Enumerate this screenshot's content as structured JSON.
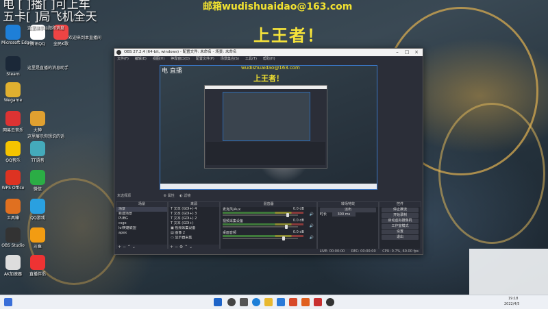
{
  "overlay": {
    "line1": "电 [   ]播[   ]可上车",
    "line2": "五卡[   ]局飞机全天",
    "email": "邮箱wudishuaidao@163.com",
    "slogan": "上王者！"
  },
  "desktop_icons": [
    {
      "label": "Microsoft Edge",
      "color": "#1e7fd8"
    },
    {
      "label": "Steam",
      "color": "#1b2838"
    },
    {
      "label": "Wegame",
      "color": "#e0b030"
    },
    {
      "label": "网易云音乐",
      "color": "#d33"
    },
    {
      "label": "QQ音乐",
      "color": "#f5c400"
    },
    {
      "label": "WPS Office",
      "color": "#d32"
    },
    {
      "label": "工具箱",
      "color": "#e07020"
    },
    {
      "label": "OBS Studio",
      "color": "#333"
    },
    {
      "label": "AK加速器",
      "color": "#ddd"
    },
    {
      "label": "直播伴侣",
      "color": "#e33"
    },
    {
      "label": "大神",
      "color": "#e0a030"
    },
    {
      "label": "TT语音",
      "color": "#4ab"
    },
    {
      "label": "腾讯QQ",
      "color": "#fff"
    },
    {
      "label": "微信",
      "color": "#2bad45"
    },
    {
      "label": "QQ游戏",
      "color": "#2aa0e0"
    },
    {
      "label": "斗鱼",
      "color": "#f39c12"
    },
    {
      "label": "全民K歌",
      "color": "#e44"
    }
  ],
  "desktop_notes": [
    "这里展示标题和消息",
    "欢迎来到本直播间",
    "这里是直播的消息助手",
    "这里展示你想说的话"
  ],
  "obs": {
    "title": "OBS 27.2.4 (64-bit, windows) - 配置文件: 未命名 - 场景: 未命名",
    "menus": [
      "文件(F)",
      "编辑(E)",
      "视图(V)",
      "停靠窗口(D)",
      "配置文件(P)",
      "场景集合(S)",
      "工具(T)",
      "帮助(H)"
    ],
    "preview_texts": {
      "email": "wudishuaidao@163.com",
      "slogan": "上王者！",
      "corner": "电 直播"
    },
    "source_bar": "未选择源",
    "source_props": "属性",
    "source_filter": "滤镜",
    "docks": {
      "scenes": {
        "title": "场景",
        "items": [
          "场景",
          "新建场景",
          "PUBG",
          "csgo",
          "lol英雄联盟",
          "apex"
        ]
      },
      "sources": {
        "title": "来源",
        "items": [
          "文本 (GDI+) 4",
          "文本 (GDI+) 3",
          "文本 (GDI+) 2",
          "文本 (GDI+)",
          "视频采集设备",
          "图像 2",
          "显示器采集"
        ]
      },
      "mixer": {
        "title": "混音器",
        "channels": [
          {
            "name": "麦克风/Aux",
            "db": "0.0 dB",
            "level": 0.88
          },
          {
            "name": "视频采集设备",
            "db": "0.0 dB",
            "level": 0.86
          },
          {
            "name": "桌面音频",
            "db": "0.0 dB",
            "level": 0.82
          }
        ]
      },
      "transitions": {
        "title": "转场特效",
        "type": "淡出",
        "duration_label": "时长",
        "duration": "300 ms"
      },
      "controls": {
        "title": "控件",
        "buttons": [
          "停止推流",
          "开始录制",
          "启动虚拟摄像机",
          "工作室模式",
          "设置",
          "退出"
        ]
      }
    },
    "status": {
      "live": "LIVE: 00:00:00",
      "rec": "REC: 00:00:00",
      "cpu": "CPU: 0.7%, 60.00 fps"
    }
  },
  "taskbar": {
    "time": "19:18",
    "date": "2022/4/5"
  }
}
